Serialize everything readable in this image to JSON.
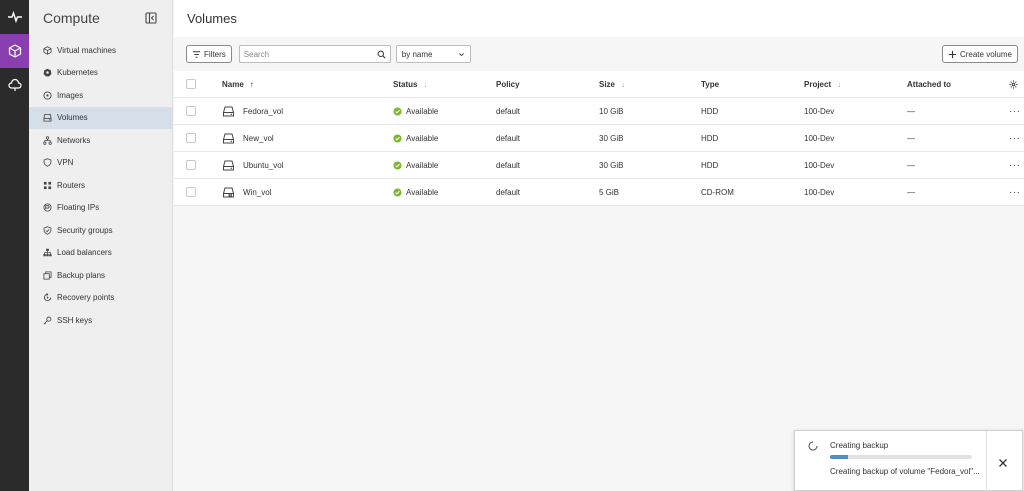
{
  "rail": {
    "items": [
      {
        "icon": "activity-icon"
      },
      {
        "icon": "cube-icon",
        "active": true
      },
      {
        "icon": "cloud-icon"
      }
    ]
  },
  "sidebar": {
    "title": "Compute",
    "items": [
      {
        "label": "Virtual machines",
        "icon": "cube-icon"
      },
      {
        "label": "Kubernetes",
        "icon": "kubernetes-icon"
      },
      {
        "label": "Images",
        "icon": "disc-icon"
      },
      {
        "label": "Volumes",
        "icon": "drive-icon",
        "active": true
      },
      {
        "label": "Networks",
        "icon": "network-icon"
      },
      {
        "label": "VPN",
        "icon": "shield-icon"
      },
      {
        "label": "Routers",
        "icon": "router-icon"
      },
      {
        "label": "Floating IPs",
        "icon": "floating-ip-icon"
      },
      {
        "label": "Security groups",
        "icon": "security-icon"
      },
      {
        "label": "Load balancers",
        "icon": "load-balancer-icon"
      },
      {
        "label": "Backup plans",
        "icon": "backup-icon"
      },
      {
        "label": "Recovery points",
        "icon": "recovery-icon"
      },
      {
        "label": "SSH keys",
        "icon": "key-icon"
      }
    ]
  },
  "main": {
    "title": "Volumes",
    "toolbar": {
      "filters_label": "Filters",
      "search_placeholder": "Search",
      "sort_value": "by name",
      "create_label": "Create volume"
    },
    "table": {
      "columns": {
        "name": "Name",
        "status": "Status",
        "policy": "Policy",
        "size": "Size",
        "type": "Type",
        "project": "Project",
        "attached": "Attached to"
      },
      "rows": [
        {
          "name": "Fedora_vol",
          "status": "Available",
          "policy": "default",
          "size": "10 GiB",
          "type": "HDD",
          "project": "100-Dev",
          "attached": "—",
          "icon": "drive-icon"
        },
        {
          "name": "New_vol",
          "status": "Available",
          "policy": "default",
          "size": "30 GiB",
          "type": "HDD",
          "project": "100-Dev",
          "attached": "—",
          "icon": "drive-icon"
        },
        {
          "name": "Ubuntu_vol",
          "status": "Available",
          "policy": "default",
          "size": "30 GiB",
          "type": "HDD",
          "project": "100-Dev",
          "attached": "—",
          "icon": "drive-icon"
        },
        {
          "name": "Win_vol",
          "status": "Available",
          "policy": "default",
          "size": "5 GiB",
          "type": "CD-ROM",
          "project": "100-Dev",
          "attached": "—",
          "icon": "drive-windows-icon"
        }
      ],
      "row_actions": "···"
    }
  },
  "toast": {
    "title": "Creating backup",
    "body": "Creating backup of volume \"Fedora_vol\"...",
    "progress": 0.13
  },
  "colors": {
    "accent": "#8a3fb0",
    "active_nav": "#d4dfe9",
    "status_ok": "#7cb82f",
    "progress": "#4f8ec9"
  }
}
